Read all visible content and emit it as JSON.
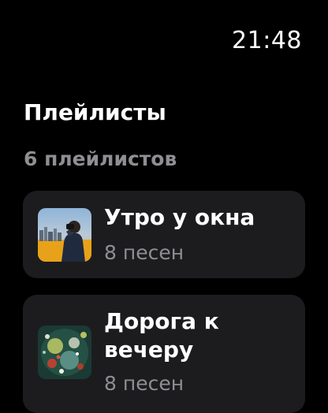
{
  "status_bar": {
    "time": "21:48"
  },
  "header": {
    "title": "Плейлисты",
    "count_label": "6 плейлистов"
  },
  "playlists": [
    {
      "title": "Утро у окна",
      "subtitle": "8 песен",
      "artwork_icon": "city-sunrise-person-artwork"
    },
    {
      "title": "Дорога к вечеру",
      "subtitle": "8 песен",
      "artwork_icon": "abstract-paint-splatter-artwork"
    }
  ],
  "colors": {
    "background": "#000000",
    "card": "#1c1c1e",
    "secondary_text": "#8e8e93",
    "primary_text": "#ffffff"
  }
}
